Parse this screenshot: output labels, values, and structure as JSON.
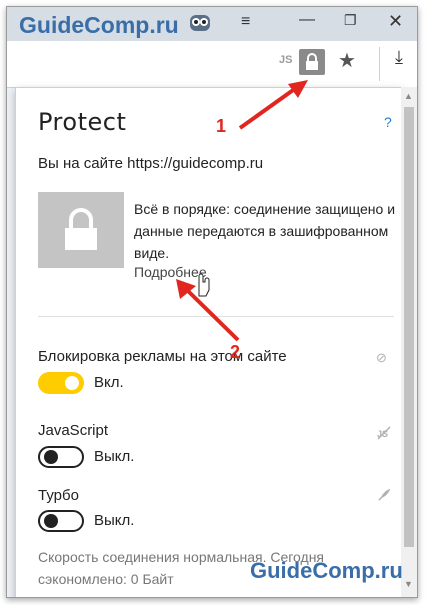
{
  "watermark": {
    "top": "GuideComp.ru",
    "bottom": "GuideComp.ru"
  },
  "titlebar": {
    "menu": "≡",
    "minimize": "—",
    "restore": "❐",
    "close": "✕"
  },
  "toolbar": {
    "js_badge": "JS",
    "star": "★",
    "download": "⤓"
  },
  "panel": {
    "title": "Protect",
    "help": "?",
    "site_line": "Вы на сайте https://guidecomp.ru",
    "info_text": "Всё в порядке: соединение защищено и данные передаются в зашифрованном виде.",
    "more_link": "Подробнее",
    "ads": {
      "label": "Блокировка рекламы на этом сайте",
      "state": "Вкл."
    },
    "javascript": {
      "label": "JavaScript",
      "state": "Выкл."
    },
    "turbo": {
      "label": "Турбо",
      "state": "Выкл."
    },
    "stats": "Скорость соединения нормальная. Сегодня сэкономлено: 0 Байт"
  },
  "annotations": {
    "marker1": "1",
    "marker2": "2"
  },
  "colors": {
    "accent_arrow": "#e0261e",
    "toggle_on": "#ffcc00",
    "brand": "#3a6ea8"
  }
}
